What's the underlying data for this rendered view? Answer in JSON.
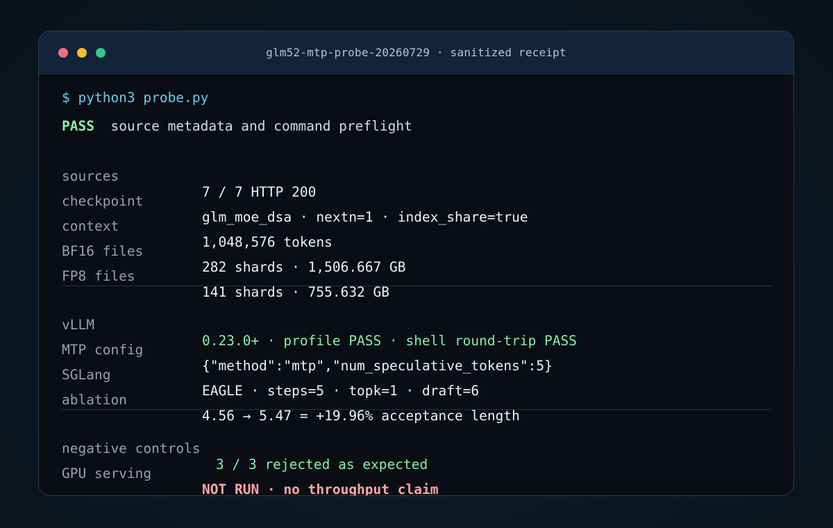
{
  "window": {
    "title": "glm52-mtp-probe-20260729 · sanitized receipt",
    "controls": [
      "close-dot",
      "minimize-dot",
      "maximize-dot"
    ]
  },
  "terminal": {
    "command": "$ python3 probe.py",
    "status": {
      "tag": "PASS",
      "text": "source metadata and command preflight"
    },
    "section1": [
      {
        "key": "sources",
        "value": "7 / 7 HTTP 200"
      },
      {
        "key": "checkpoint",
        "value": "glm_moe_dsa · nextn=1 · index_share=true"
      },
      {
        "key": "context",
        "value": "1,048,576 tokens"
      },
      {
        "key": "BF16 files",
        "value": "282 shards · 1,506.667 GB"
      },
      {
        "key": "FP8 files",
        "value": "141 shards · 755.632 GB"
      }
    ],
    "section2": [
      {
        "key": "vLLM",
        "value": "0.23.0+ · profile PASS · shell round-trip PASS"
      },
      {
        "key": "MTP config",
        "value": "{\"method\":\"mtp\",\"num_speculative_tokens\":5}"
      },
      {
        "key": "SGLang",
        "value": "EAGLE · steps=5 · topk=1 · draft=6"
      },
      {
        "key": "ablation",
        "value": "4.56 → 5.47 = +19.96% acceptance length"
      }
    ],
    "section3": [
      {
        "key": "negative controls",
        "value": "3 / 3 rejected as expected"
      },
      {
        "key": "GPU serving",
        "value": "NOT RUN · no throughput claim"
      }
    ]
  },
  "colors": {
    "background": "#0b1822",
    "window": "#0b0d14",
    "titlebar": "#13233a",
    "prompt": "#5ed2ee",
    "pass": "#86efac",
    "fail": "#fca5a5",
    "key": "#93a1b2",
    "value": "#eef1f6"
  }
}
